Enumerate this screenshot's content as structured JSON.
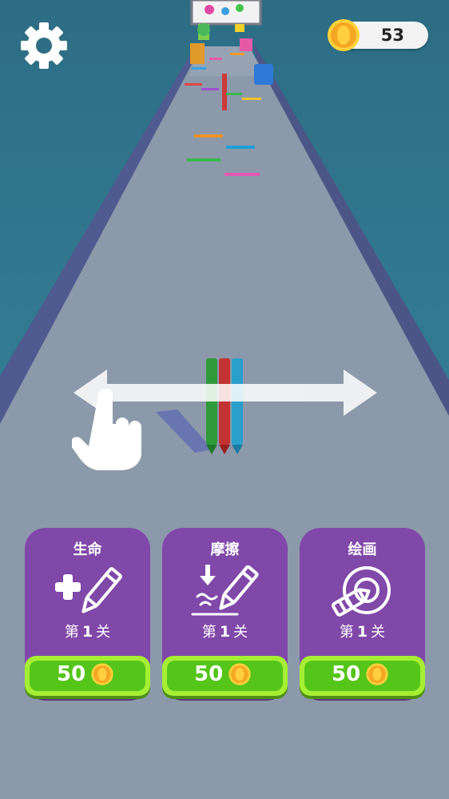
{
  "hud": {
    "coins": "53"
  },
  "upgrades": [
    {
      "title": "生命",
      "level_prefix": "第",
      "level": "1",
      "level_suffix": "关",
      "price": "50"
    },
    {
      "title": "摩擦",
      "level_prefix": "第",
      "level": "1",
      "level_suffix": "关",
      "price": "50"
    },
    {
      "title": "绘画",
      "level_prefix": "第",
      "level": "1",
      "level_suffix": "关",
      "price": "50"
    }
  ],
  "colors": {
    "sky": "#2f6f86",
    "road": "#8a98a8",
    "card": "#8048a9",
    "button_outer": "#a6ee34",
    "button_inner": "#55c51a",
    "coin": "#f5a623"
  },
  "icons": {
    "settings": "gear-icon",
    "coin": "coin-icon",
    "swipe": "swipe-arrow-icon",
    "hand": "pointing-hand-icon",
    "life": "plus-pencil-icon",
    "friction": "friction-pencil-icon",
    "draw": "crayon-target-icon"
  }
}
